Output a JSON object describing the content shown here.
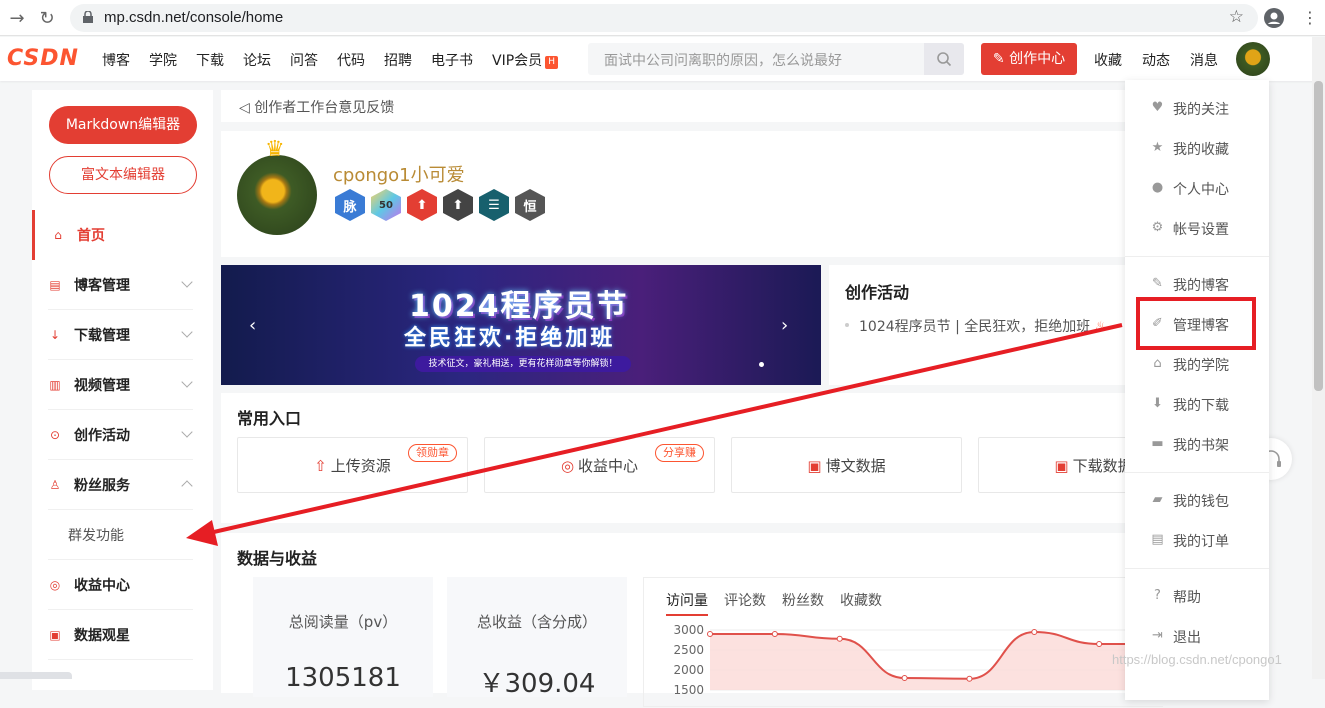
{
  "browser": {
    "url": "mp.csdn.net/console/home"
  },
  "header": {
    "logo_main": "CSDN",
    "nav": [
      "博客",
      "学院",
      "下载",
      "论坛",
      "问答",
      "代码",
      "招聘",
      "电子书",
      "VIP会员"
    ],
    "vip_badge": "H",
    "search_placeholder": "面试中公司问离职的原因，怎么说最好",
    "create_label": "创作中心",
    "right_links": [
      "收藏",
      "动态",
      "消息"
    ]
  },
  "sidebar": {
    "markdown_btn": "Markdown编辑器",
    "richtext_btn": "富文本编辑器",
    "items": [
      {
        "label": "首页",
        "icon": "home-icon"
      },
      {
        "label": "博客管理",
        "icon": "doc-icon"
      },
      {
        "label": "下载管理",
        "icon": "download-icon"
      },
      {
        "label": "视频管理",
        "icon": "video-icon"
      },
      {
        "label": "创作活动",
        "icon": "activity-icon"
      },
      {
        "label": "粉丝服务",
        "icon": "fans-icon"
      },
      {
        "label": "群发功能",
        "icon": ""
      },
      {
        "label": "收益中心",
        "icon": "money-icon"
      },
      {
        "label": "数据观星",
        "icon": "chart-icon"
      }
    ]
  },
  "feedback": {
    "text": "创作者工作台意见反馈"
  },
  "profile": {
    "name": "cpongo1小可爱",
    "badges": [
      "脉",
      "50",
      "",
      "",
      "",
      "恒"
    ]
  },
  "banner": {
    "title": "1024程序员节",
    "subtitle": "全民狂欢·拒绝加班",
    "caption": "技术征文，豪礼相送，更有花样勋章等你解锁！"
  },
  "activity": {
    "heading": "创作活动",
    "item": "1024程序员节 | 全民狂欢，拒绝加班"
  },
  "common": {
    "heading": "常用入口",
    "entries": [
      {
        "label": "上传资源",
        "tag": "领勋章",
        "icon": "upload-icon"
      },
      {
        "label": "收益中心",
        "tag": "分享赚",
        "icon": "money-icon"
      },
      {
        "label": "博文数据",
        "tag": "",
        "icon": "chart-icon"
      },
      {
        "label": "下载数据",
        "tag": "",
        "icon": "chart-icon"
      }
    ]
  },
  "data_section": {
    "heading": "数据与收益",
    "stats": [
      {
        "label": "总阅读量（pv）",
        "value": "1305181"
      },
      {
        "label": "总收益（含分成）",
        "value": "￥309.04"
      }
    ],
    "chart_tabs": [
      "访问量",
      "评论数",
      "粉丝数",
      "收藏数"
    ]
  },
  "chart_data": {
    "type": "area",
    "y_ticks": [
      "3000",
      "2500",
      "2000",
      "1500"
    ],
    "ylim": [
      1500,
      3000
    ],
    "values": [
      2900,
      2900,
      2780,
      1800,
      1780,
      2950,
      2650,
      2650
    ],
    "color": "#e0514b"
  },
  "dropdown": {
    "items": [
      {
        "label": "我的关注",
        "icon": "heart-icon"
      },
      {
        "label": "我的收藏",
        "icon": "star-icon"
      },
      {
        "label": "个人中心",
        "icon": "user-icon"
      },
      {
        "label": "帐号设置",
        "icon": "settings-icon"
      },
      {
        "label": "我的博客",
        "icon": "pen-icon"
      },
      {
        "label": "管理博客",
        "icon": "manage-icon"
      },
      {
        "label": "我的学院",
        "icon": "school-icon"
      },
      {
        "label": "我的下载",
        "icon": "download-icon"
      },
      {
        "label": "我的书架",
        "icon": "book-icon"
      },
      {
        "label": "我的钱包",
        "icon": "wallet-icon"
      },
      {
        "label": "我的订单",
        "icon": "order-icon"
      },
      {
        "label": "帮助",
        "icon": "help-icon"
      },
      {
        "label": "退出",
        "icon": "logout-icon"
      }
    ]
  },
  "watermark": "https://blog.csdn.net/cpongo1",
  "colors": {
    "brand": "#e33e33",
    "annotation": "#e61e24"
  }
}
